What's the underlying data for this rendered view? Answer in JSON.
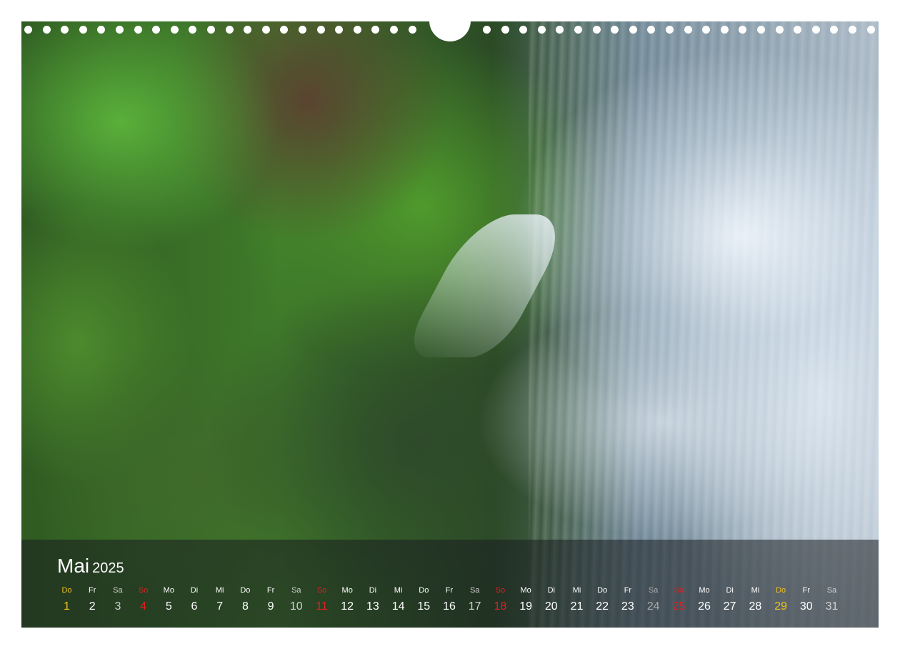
{
  "calendar": {
    "month": "Mai",
    "year": "2025",
    "days": [
      {
        "wd": "Do",
        "n": "1",
        "type": "hol"
      },
      {
        "wd": "Fr",
        "n": "2",
        "type": "normal"
      },
      {
        "wd": "Sa",
        "n": "3",
        "type": "sat"
      },
      {
        "wd": "So",
        "n": "4",
        "type": "sun"
      },
      {
        "wd": "Mo",
        "n": "5",
        "type": "normal"
      },
      {
        "wd": "Di",
        "n": "6",
        "type": "normal"
      },
      {
        "wd": "Mi",
        "n": "7",
        "type": "normal"
      },
      {
        "wd": "Do",
        "n": "8",
        "type": "normal"
      },
      {
        "wd": "Fr",
        "n": "9",
        "type": "normal"
      },
      {
        "wd": "Sa",
        "n": "10",
        "type": "sat"
      },
      {
        "wd": "So",
        "n": "11",
        "type": "sun"
      },
      {
        "wd": "Mo",
        "n": "12",
        "type": "normal"
      },
      {
        "wd": "Di",
        "n": "13",
        "type": "normal"
      },
      {
        "wd": "Mi",
        "n": "14",
        "type": "normal"
      },
      {
        "wd": "Do",
        "n": "15",
        "type": "normal"
      },
      {
        "wd": "Fr",
        "n": "16",
        "type": "normal"
      },
      {
        "wd": "Sa",
        "n": "17",
        "type": "sat"
      },
      {
        "wd": "So",
        "n": "18",
        "type": "sun"
      },
      {
        "wd": "Mo",
        "n": "19",
        "type": "normal"
      },
      {
        "wd": "Di",
        "n": "20",
        "type": "normal"
      },
      {
        "wd": "Mi",
        "n": "21",
        "type": "normal"
      },
      {
        "wd": "Do",
        "n": "22",
        "type": "normal"
      },
      {
        "wd": "Fr",
        "n": "23",
        "type": "normal"
      },
      {
        "wd": "Sa",
        "n": "24",
        "type": "satgrey"
      },
      {
        "wd": "So",
        "n": "25",
        "type": "sun"
      },
      {
        "wd": "Mo",
        "n": "26",
        "type": "normal"
      },
      {
        "wd": "Di",
        "n": "27",
        "type": "normal"
      },
      {
        "wd": "Mi",
        "n": "28",
        "type": "normal"
      },
      {
        "wd": "Do",
        "n": "29",
        "type": "hol"
      },
      {
        "wd": "Fr",
        "n": "30",
        "type": "normal"
      },
      {
        "wd": "Sa",
        "n": "31",
        "type": "sat"
      }
    ]
  },
  "colors": {
    "sunday": "#e02020",
    "holiday": "#f0c020",
    "text": "#ffffff"
  }
}
